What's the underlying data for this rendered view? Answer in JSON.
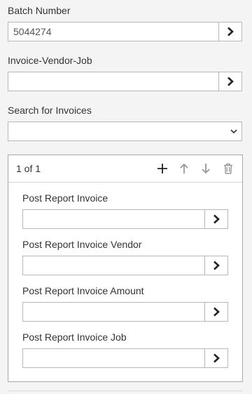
{
  "batch": {
    "label": "Batch Number",
    "value": "5044274",
    "action_icon": "chevron-right-icon"
  },
  "ivj": {
    "label": "Invoice-Vendor-Job",
    "value": "",
    "action_icon": "chevron-right-icon"
  },
  "search": {
    "label": "Search for Invoices",
    "selected": "",
    "dropdown_icon": "chevron-down-icon"
  },
  "panel": {
    "counter": "1 of 1",
    "tools": [
      "plus-icon",
      "arrow-up-icon",
      "arrow-down-icon",
      "trash-icon"
    ],
    "fields": [
      {
        "label": "Post Report Invoice",
        "value": ""
      },
      {
        "label": "Post Report Invoice Vendor",
        "value": ""
      },
      {
        "label": "Post Report Invoice Amount",
        "value": ""
      },
      {
        "label": "Post Report Invoice Job",
        "value": ""
      }
    ]
  },
  "colors": {
    "background": "#f4f4f4",
    "border": "#b8b8b8",
    "text": "#333333",
    "icon_dark": "#222222",
    "icon_disabled": "#999999"
  }
}
